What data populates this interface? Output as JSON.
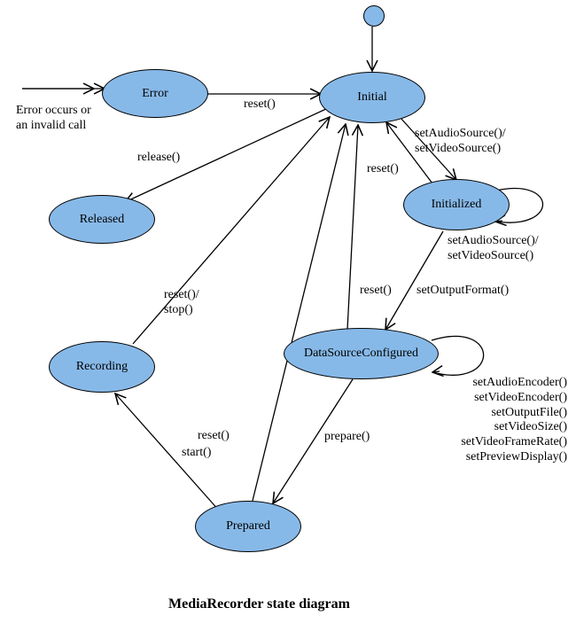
{
  "diagram_title": "MediaRecorder state diagram",
  "states": {
    "error": "Error",
    "initial": "Initial",
    "released": "Released",
    "initialized": "Initialized",
    "datasource": "DataSourceConfigured",
    "recording": "Recording",
    "prepared": "Prepared"
  },
  "labels": {
    "error_caption_l1": "Error occurs or",
    "error_caption_l2": "an invalid call",
    "reset_error_initial": "reset()",
    "release": "release()",
    "setSource_l1": "setAudioSource()/",
    "setSource_l2": "setVideoSource()",
    "reset_initialized_initial": "reset()",
    "initialized_self_l1": "setAudioSource()/",
    "initialized_self_l2": "setVideoSource()",
    "setOutputFormat": "setOutputFormat()",
    "reset_ds_initial": "reset()",
    "ds_self_l1": "setAudioEncoder()",
    "ds_self_l2": "setVideoEncoder()",
    "ds_self_l3": "setOutputFile()",
    "ds_self_l4": "setVideoSize()",
    "ds_self_l5": "setVideoFrameRate()",
    "ds_self_l6": "setPreviewDisplay()",
    "prepare": "prepare()",
    "reset_prepared_initial": "reset()",
    "start": "start()",
    "reset_stop_l1": "reset()/",
    "reset_stop_l2": "stop()"
  }
}
